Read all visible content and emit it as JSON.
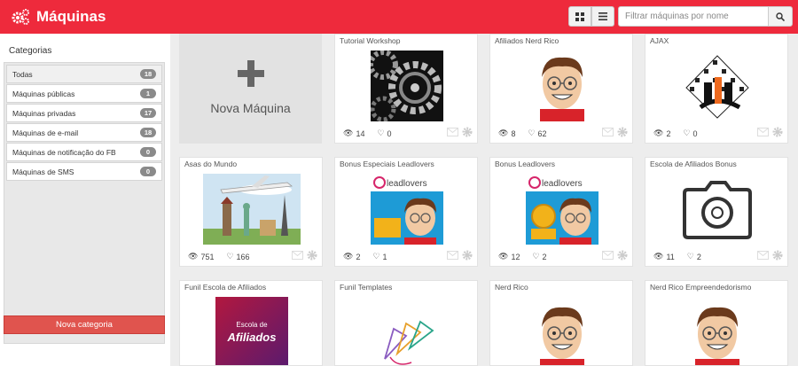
{
  "app": {
    "title": "Máquinas",
    "logo_icon": "gears-icon"
  },
  "toolbar": {
    "grid_icon": "grid-view-icon",
    "list_icon": "list-view-icon",
    "search_placeholder": "Filtrar máquinas por nome",
    "search_icon": "search-icon"
  },
  "sidebar": {
    "title": "Categorias",
    "items": [
      {
        "label": "Todas",
        "count": "18"
      },
      {
        "label": "Máquinas públicas",
        "count": "1"
      },
      {
        "label": "Máquinas privadas",
        "count": "17"
      },
      {
        "label": "Máquinas de e-mail",
        "count": "18"
      },
      {
        "label": "Máquinas de notificação do FB",
        "count": "0"
      },
      {
        "label": "Máquinas de SMS",
        "count": "0"
      }
    ],
    "new_category_label": "Nova categoria"
  },
  "new_machine": {
    "label": "Nova Máquina"
  },
  "machines": [
    {
      "title": "Tutorial Workshop",
      "views": "14",
      "likes": "0"
    },
    {
      "title": "Afiliados Nerd Rico",
      "views": "8",
      "likes": "62"
    },
    {
      "title": "AJAX",
      "views": "2",
      "likes": "0"
    },
    {
      "title": "Asas do Mundo",
      "views": "751",
      "likes": "166"
    },
    {
      "title": "Bonus Especiais Leadlovers",
      "views": "2",
      "likes": "1"
    },
    {
      "title": "Bonus Leadlovers",
      "views": "12",
      "likes": "2"
    },
    {
      "title": "Escola de Afiliados Bonus",
      "views": "11",
      "likes": "2"
    },
    {
      "title": "Funil Escola de Afiliados"
    },
    {
      "title": "Funil Templates"
    },
    {
      "title": "Nerd Rico"
    },
    {
      "title": "Nerd Rico Empreendedorismo"
    }
  ],
  "thumb_text": {
    "leadlovers": "leadlovers",
    "escola_top": "Escola de",
    "escola_main": "Afiliados"
  },
  "colors": {
    "header": "#ee2a3c",
    "new_category_button": "#e0544e",
    "badge": "#8a8a8a"
  }
}
